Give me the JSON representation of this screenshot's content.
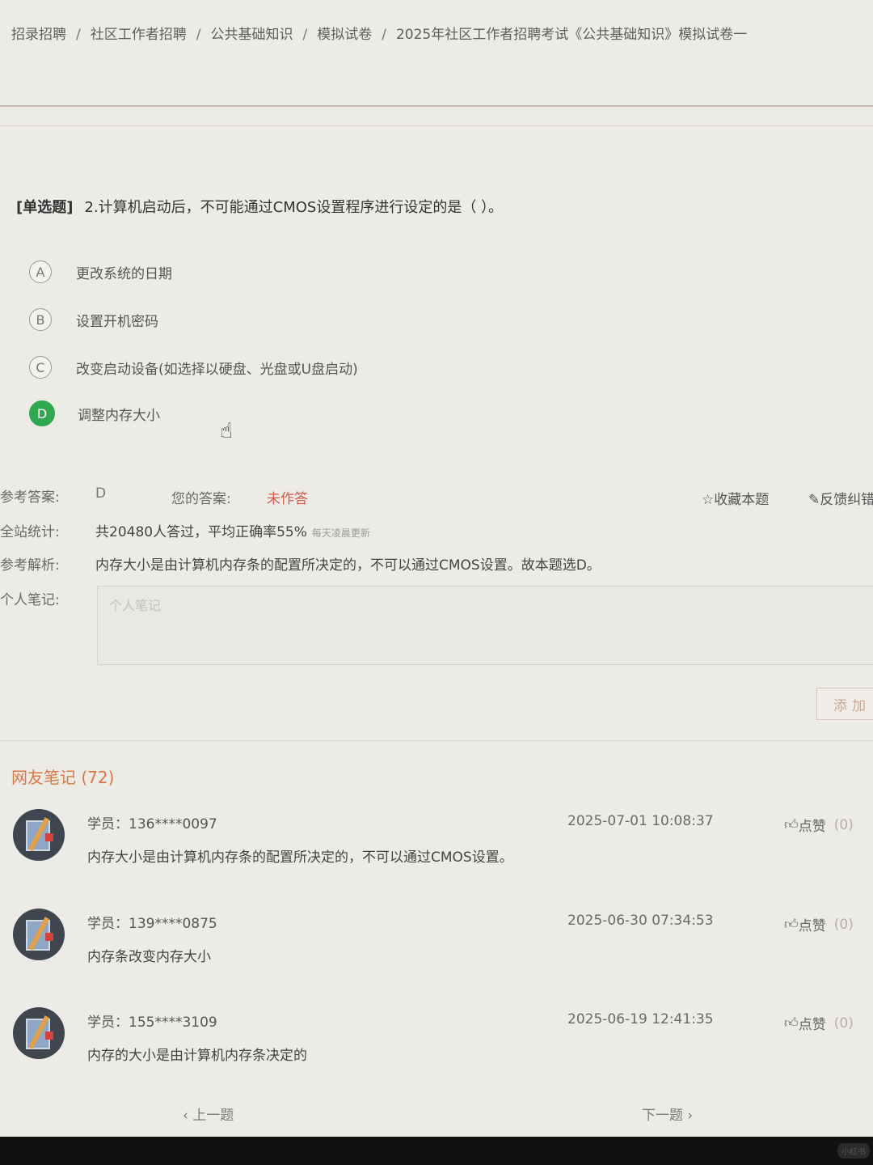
{
  "breadcrumb": {
    "items": [
      "招录招聘",
      "社区工作者招聘",
      "公共基础知识",
      "模拟试卷",
      "2025年社区工作者招聘考试《公共基础知识》模拟试卷一"
    ],
    "separator": "/"
  },
  "question": {
    "type": "[单选题]",
    "text": "2.计算机启动后，不可能通过CMOS设置程序进行设定的是（    ）。",
    "options": [
      {
        "letter": "A",
        "text": "更改系统的日期"
      },
      {
        "letter": "B",
        "text": "设置开机密码"
      },
      {
        "letter": "C",
        "text": "改变启动设备(如选择以硬盘、光盘或U盘启动)"
      },
      {
        "letter": "D",
        "text": "调整内存大小"
      }
    ],
    "selected": "D"
  },
  "answer_panel": {
    "ref_label": "参考答案:",
    "ref_value": "D",
    "your_label": "您的答案:",
    "your_value": "未作答",
    "favorite": "收藏本题",
    "feedback": "反馈纠错",
    "stats_label": "全站统计:",
    "stats_value": "共20480人答过，平均正确率55%",
    "stats_note": "每天凌晨更新",
    "analysis_label": "参考解析:",
    "analysis_value": "内存大小是由计算机内存条的配置所决定的，不可以通过CMOS设置。故本题选D。",
    "note_label": "个人笔记:",
    "note_placeholder": "个人笔记",
    "add_button": "添加"
  },
  "notes": {
    "title": "网友笔记",
    "count": "(72)",
    "like_label": "点赞",
    "items": [
      {
        "user": "学员：136****0097",
        "time": "2025-07-01 10:08:37",
        "likes": "(0)",
        "text": "内存大小是由计算机内存条的配置所决定的，不可以通过CMOS设置。"
      },
      {
        "user": "学员：139****0875",
        "time": "2025-06-30 07:34:53",
        "likes": "(0)",
        "text": "内存条改变内存大小"
      },
      {
        "user": "学员：155****3109",
        "time": "2025-06-19 12:41:35",
        "likes": "(0)",
        "text": "内存的大小是由计算机内存条决定的"
      }
    ]
  },
  "pager": {
    "prev": "上一题",
    "next": "下一题"
  },
  "watermark": "小红书",
  "colors": {
    "selected_option": "#2fa84f",
    "unanswered": "#d05a4c",
    "notes_title": "#d77848"
  }
}
